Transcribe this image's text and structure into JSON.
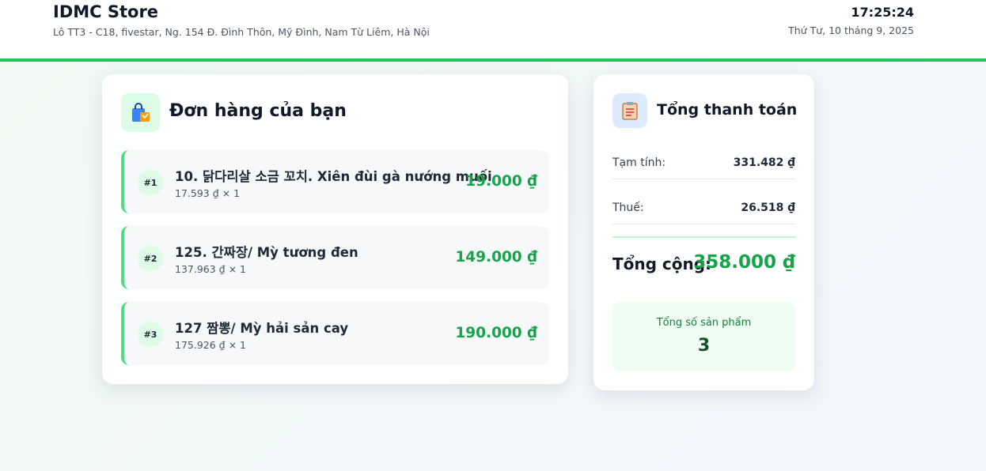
{
  "header": {
    "store_name": "IDMC Store",
    "address": "Lô TT3 - C18, fivestar, Ng. 154 Đ. Đình Thôn, Mỹ Đình, Nam Từ Liêm, Hà Nội",
    "time": "17:25:24",
    "date": "Thứ Tư, 10 tháng 9, 2025"
  },
  "order": {
    "title": "Đơn hàng của bạn",
    "icon": "shopping-bag-icon",
    "items": [
      {
        "num": "#1",
        "name": "10. 닭다리살 소금 꼬치. Xiên đùi gà nướng muối",
        "detail": "17.593 ₫ × 1",
        "price": "19.000 ₫"
      },
      {
        "num": "#2",
        "name": "125. 간짜장/ Mỳ tương đen",
        "detail": "137.963 ₫ × 1",
        "price": "149.000 ₫"
      },
      {
        "num": "#3",
        "name": "127 짬뽕/ Mỳ hải sản cay",
        "detail": "175.926 ₫ × 1",
        "price": "190.000 ₫"
      }
    ]
  },
  "summary": {
    "title": "Tổng thanh toán",
    "icon": "clipboard-icon",
    "subtotal_label": "Tạm tính:",
    "subtotal_value": "331.482 ₫",
    "tax_label": "Thuế:",
    "tax_value": "26.518 ₫",
    "total_label": "Tổng cộng:",
    "total_value": "358.000 ₫",
    "count_label": "Tổng số sản phẩm",
    "count_value": "3"
  },
  "colors": {
    "accent": "#22c55e",
    "price": "#16a34a",
    "item_border": "#4ade80"
  }
}
